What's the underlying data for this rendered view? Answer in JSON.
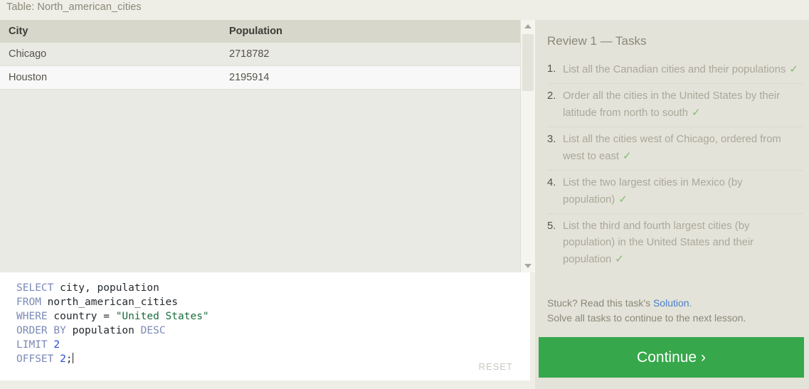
{
  "table_label": "Table: North_american_cities",
  "results": {
    "columns": [
      "City",
      "Population"
    ],
    "rows": [
      [
        "Chicago",
        "2718782"
      ],
      [
        "Houston",
        "2195914"
      ]
    ]
  },
  "editor": {
    "reset_label": "RESET",
    "lines": [
      [
        {
          "t": "SELECT",
          "c": "kw"
        },
        {
          "t": " city, population",
          "c": "ident"
        }
      ],
      [
        {
          "t": "FROM",
          "c": "kw"
        },
        {
          "t": " north_american_cities",
          "c": "ident"
        }
      ],
      [
        {
          "t": "WHERE",
          "c": "kw"
        },
        {
          "t": " country ",
          "c": "ident"
        },
        {
          "t": "=",
          "c": "pn"
        },
        {
          "t": " ",
          "c": "ident"
        },
        {
          "t": "\"United States\"",
          "c": "str"
        }
      ],
      [
        {
          "t": "ORDER",
          "c": "kw"
        },
        {
          "t": " ",
          "c": "ident"
        },
        {
          "t": "BY",
          "c": "kw"
        },
        {
          "t": " population ",
          "c": "ident"
        },
        {
          "t": "DESC",
          "c": "kw"
        }
      ],
      [
        {
          "t": "LIMIT",
          "c": "kw"
        },
        {
          "t": " ",
          "c": "ident"
        },
        {
          "t": "2",
          "c": "num"
        }
      ],
      [
        {
          "t": "OFFSET",
          "c": "kw"
        },
        {
          "t": " ",
          "c": "ident"
        },
        {
          "t": "2",
          "c": "num"
        },
        {
          "t": ";",
          "c": "pn"
        }
      ]
    ]
  },
  "tasks_panel": {
    "title": "Review 1 — Tasks",
    "check_glyph": "✓",
    "tasks": [
      {
        "num": "1.",
        "text": "List all the Canadian cities and their populations",
        "done": true
      },
      {
        "num": "2.",
        "text": "Order all the cities in the United States by their latitude from north to south",
        "done": true
      },
      {
        "num": "3.",
        "text": "List all the cities west of Chicago, ordered from west to east",
        "done": true
      },
      {
        "num": "4.",
        "text": "List the two largest cities in Mexico (by population)",
        "done": true
      },
      {
        "num": "5.",
        "text": "List the third and fourth largest cities (by population) in the United States and their population",
        "done": true
      }
    ],
    "hint_prefix": "Stuck? Read this task's ",
    "hint_link": "Solution",
    "hint_suffix": ".",
    "hint_line2": "Solve all tasks to continue to the next lesson.",
    "continue_label": "Continue ›"
  },
  "colors": {
    "page_background": "#efeee6",
    "panel_background": "#e4e3d9",
    "table_header": "#d8d7cb",
    "accent_green": "#36a84b",
    "check_green": "#82bb72",
    "link_blue": "#4a7ec8"
  }
}
